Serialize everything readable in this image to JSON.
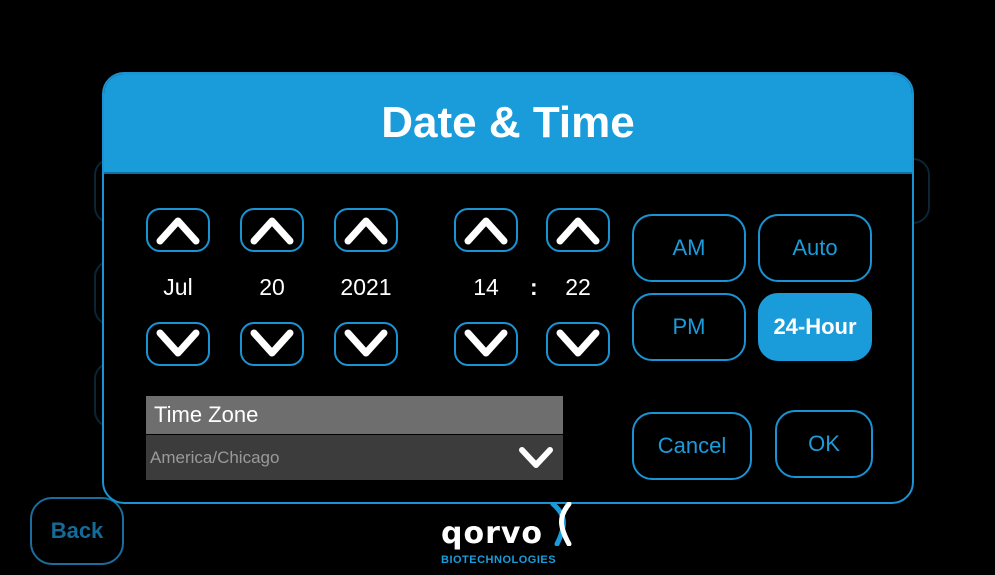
{
  "modal": {
    "title": "Date & Time"
  },
  "date": {
    "month": "Jul",
    "day": "20",
    "year": "2021"
  },
  "time": {
    "hour": "14",
    "separator": ":",
    "minute": "22"
  },
  "options": {
    "am": "AM",
    "pm": "PM",
    "auto": "Auto",
    "hour24": "24-Hour",
    "selected": "24-Hour"
  },
  "timezone": {
    "label": "Time Zone",
    "value": "America/Chicago"
  },
  "actions": {
    "cancel": "Cancel",
    "ok": "OK"
  },
  "nav": {
    "back": "Back"
  },
  "logo": {
    "word": "qorvo",
    "sub": "BIOTECHNOLOGIES"
  },
  "colors": {
    "accent": "#1a9cdb",
    "background": "#000000",
    "tz_label_bg": "#6e6e6e",
    "tz_select_bg": "#3c3c3c"
  },
  "icons": {
    "up": "chevron-up-icon",
    "down": "chevron-down-icon"
  }
}
